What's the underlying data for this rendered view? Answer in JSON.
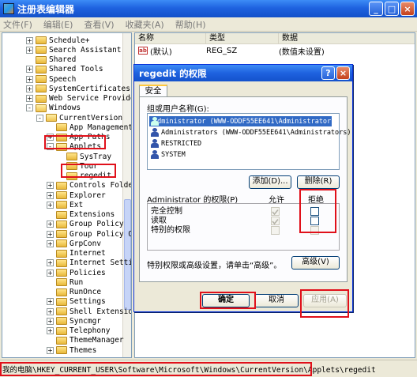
{
  "window": {
    "title": "注册表编辑器",
    "buttons": [
      "_",
      "□",
      "×"
    ]
  },
  "menu": [
    "文件(F)",
    "编辑(E)",
    "查看(V)",
    "收藏夹(A)",
    "帮助(H)"
  ],
  "tree": {
    "items": [
      {
        "label": "Schedule+",
        "depth": 2,
        "expander": "+"
      },
      {
        "label": "Search Assistant",
        "depth": 2,
        "expander": "+"
      },
      {
        "label": "Shared",
        "depth": 2,
        "expander": ""
      },
      {
        "label": "Shared Tools",
        "depth": 2,
        "expander": "+"
      },
      {
        "label": "Speech",
        "depth": 2,
        "expander": "+"
      },
      {
        "label": "SystemCertificates",
        "depth": 2,
        "expander": "+"
      },
      {
        "label": "Web Service Providers",
        "depth": 2,
        "expander": "+"
      },
      {
        "label": "Windows",
        "depth": 2,
        "expander": "-"
      },
      {
        "label": "CurrentVersion",
        "depth": 3,
        "expander": "-"
      },
      {
        "label": "App Management",
        "depth": 4,
        "expander": ""
      },
      {
        "label": "App Paths",
        "depth": 4,
        "expander": "+"
      },
      {
        "label": "Applets",
        "depth": 4,
        "expander": "-"
      },
      {
        "label": "SysTray",
        "depth": 5,
        "expander": ""
      },
      {
        "label": "Tour",
        "depth": 5,
        "expander": ""
      },
      {
        "label": "regedit",
        "depth": 5,
        "expander": ""
      },
      {
        "label": "Controls Folder",
        "depth": 4,
        "expander": "+"
      },
      {
        "label": "Explorer",
        "depth": 4,
        "expander": "+"
      },
      {
        "label": "Ext",
        "depth": 4,
        "expander": "+"
      },
      {
        "label": "Extensions",
        "depth": 4,
        "expander": ""
      },
      {
        "label": "Group Policy",
        "depth": 4,
        "expander": "+"
      },
      {
        "label": "Group Policy Objects",
        "depth": 4,
        "expander": "+"
      },
      {
        "label": "GrpConv",
        "depth": 4,
        "expander": "+"
      },
      {
        "label": "Internet",
        "depth": 4,
        "expander": ""
      },
      {
        "label": "Internet Settings",
        "depth": 4,
        "expander": "+"
      },
      {
        "label": "Policies",
        "depth": 4,
        "expander": "+"
      },
      {
        "label": "Run",
        "depth": 4,
        "expander": ""
      },
      {
        "label": "RunOnce",
        "depth": 4,
        "expander": ""
      },
      {
        "label": "Settings",
        "depth": 4,
        "expander": "+"
      },
      {
        "label": "Shell Extensions",
        "depth": 4,
        "expander": "+"
      },
      {
        "label": "Syncmgr",
        "depth": 4,
        "expander": "+"
      },
      {
        "label": "Telephony",
        "depth": 4,
        "expander": "+"
      },
      {
        "label": "ThemeManager",
        "depth": 4,
        "expander": ""
      },
      {
        "label": "Themes",
        "depth": 4,
        "expander": "+"
      }
    ]
  },
  "list": {
    "headers": [
      "名称",
      "类型",
      "数据"
    ],
    "rows": [
      {
        "icon": "ab",
        "name": "(默认)",
        "type": "REG_SZ",
        "data": "(数值未设置)"
      }
    ]
  },
  "dialog": {
    "title": "regedit 的权限",
    "buttons": [
      "?",
      "×"
    ],
    "tab": "安全",
    "group_label": "组或用户名称(G):",
    "users": [
      "Administrator (WWW-ODDF55EE641\\Administrator)",
      "Administrators (WWW-ODDF55EE641\\Administrators)",
      "RESTRICTED",
      "SYSTEM"
    ],
    "add_button": "添加(D)...",
    "remove_button": "删除(R)",
    "perm_label": "Administrator 的权限(P)",
    "allow_header": "允许",
    "deny_header": "拒绝",
    "permissions": [
      {
        "name": "完全控制",
        "allow": true,
        "deny": false
      },
      {
        "name": "读取",
        "allow": true,
        "deny": false
      },
      {
        "name": "特别的权限",
        "allow": false,
        "deny": false
      }
    ],
    "special_text": "特别权限或高级设置，请单击“高级”。",
    "advanced_button": "高级(V)",
    "ok_button": "确定",
    "cancel_button": "取消",
    "apply_button": "应用(A)"
  },
  "status": {
    "path": "我的电脑\\HKEY_CURRENT_USER\\Software\\Microsoft\\Windows\\CurrentVersion\\Applets\\regedit"
  },
  "colors": {
    "highlight": "#e0101a",
    "selection": "#316ac5",
    "titlebar": "#1f63e0"
  }
}
